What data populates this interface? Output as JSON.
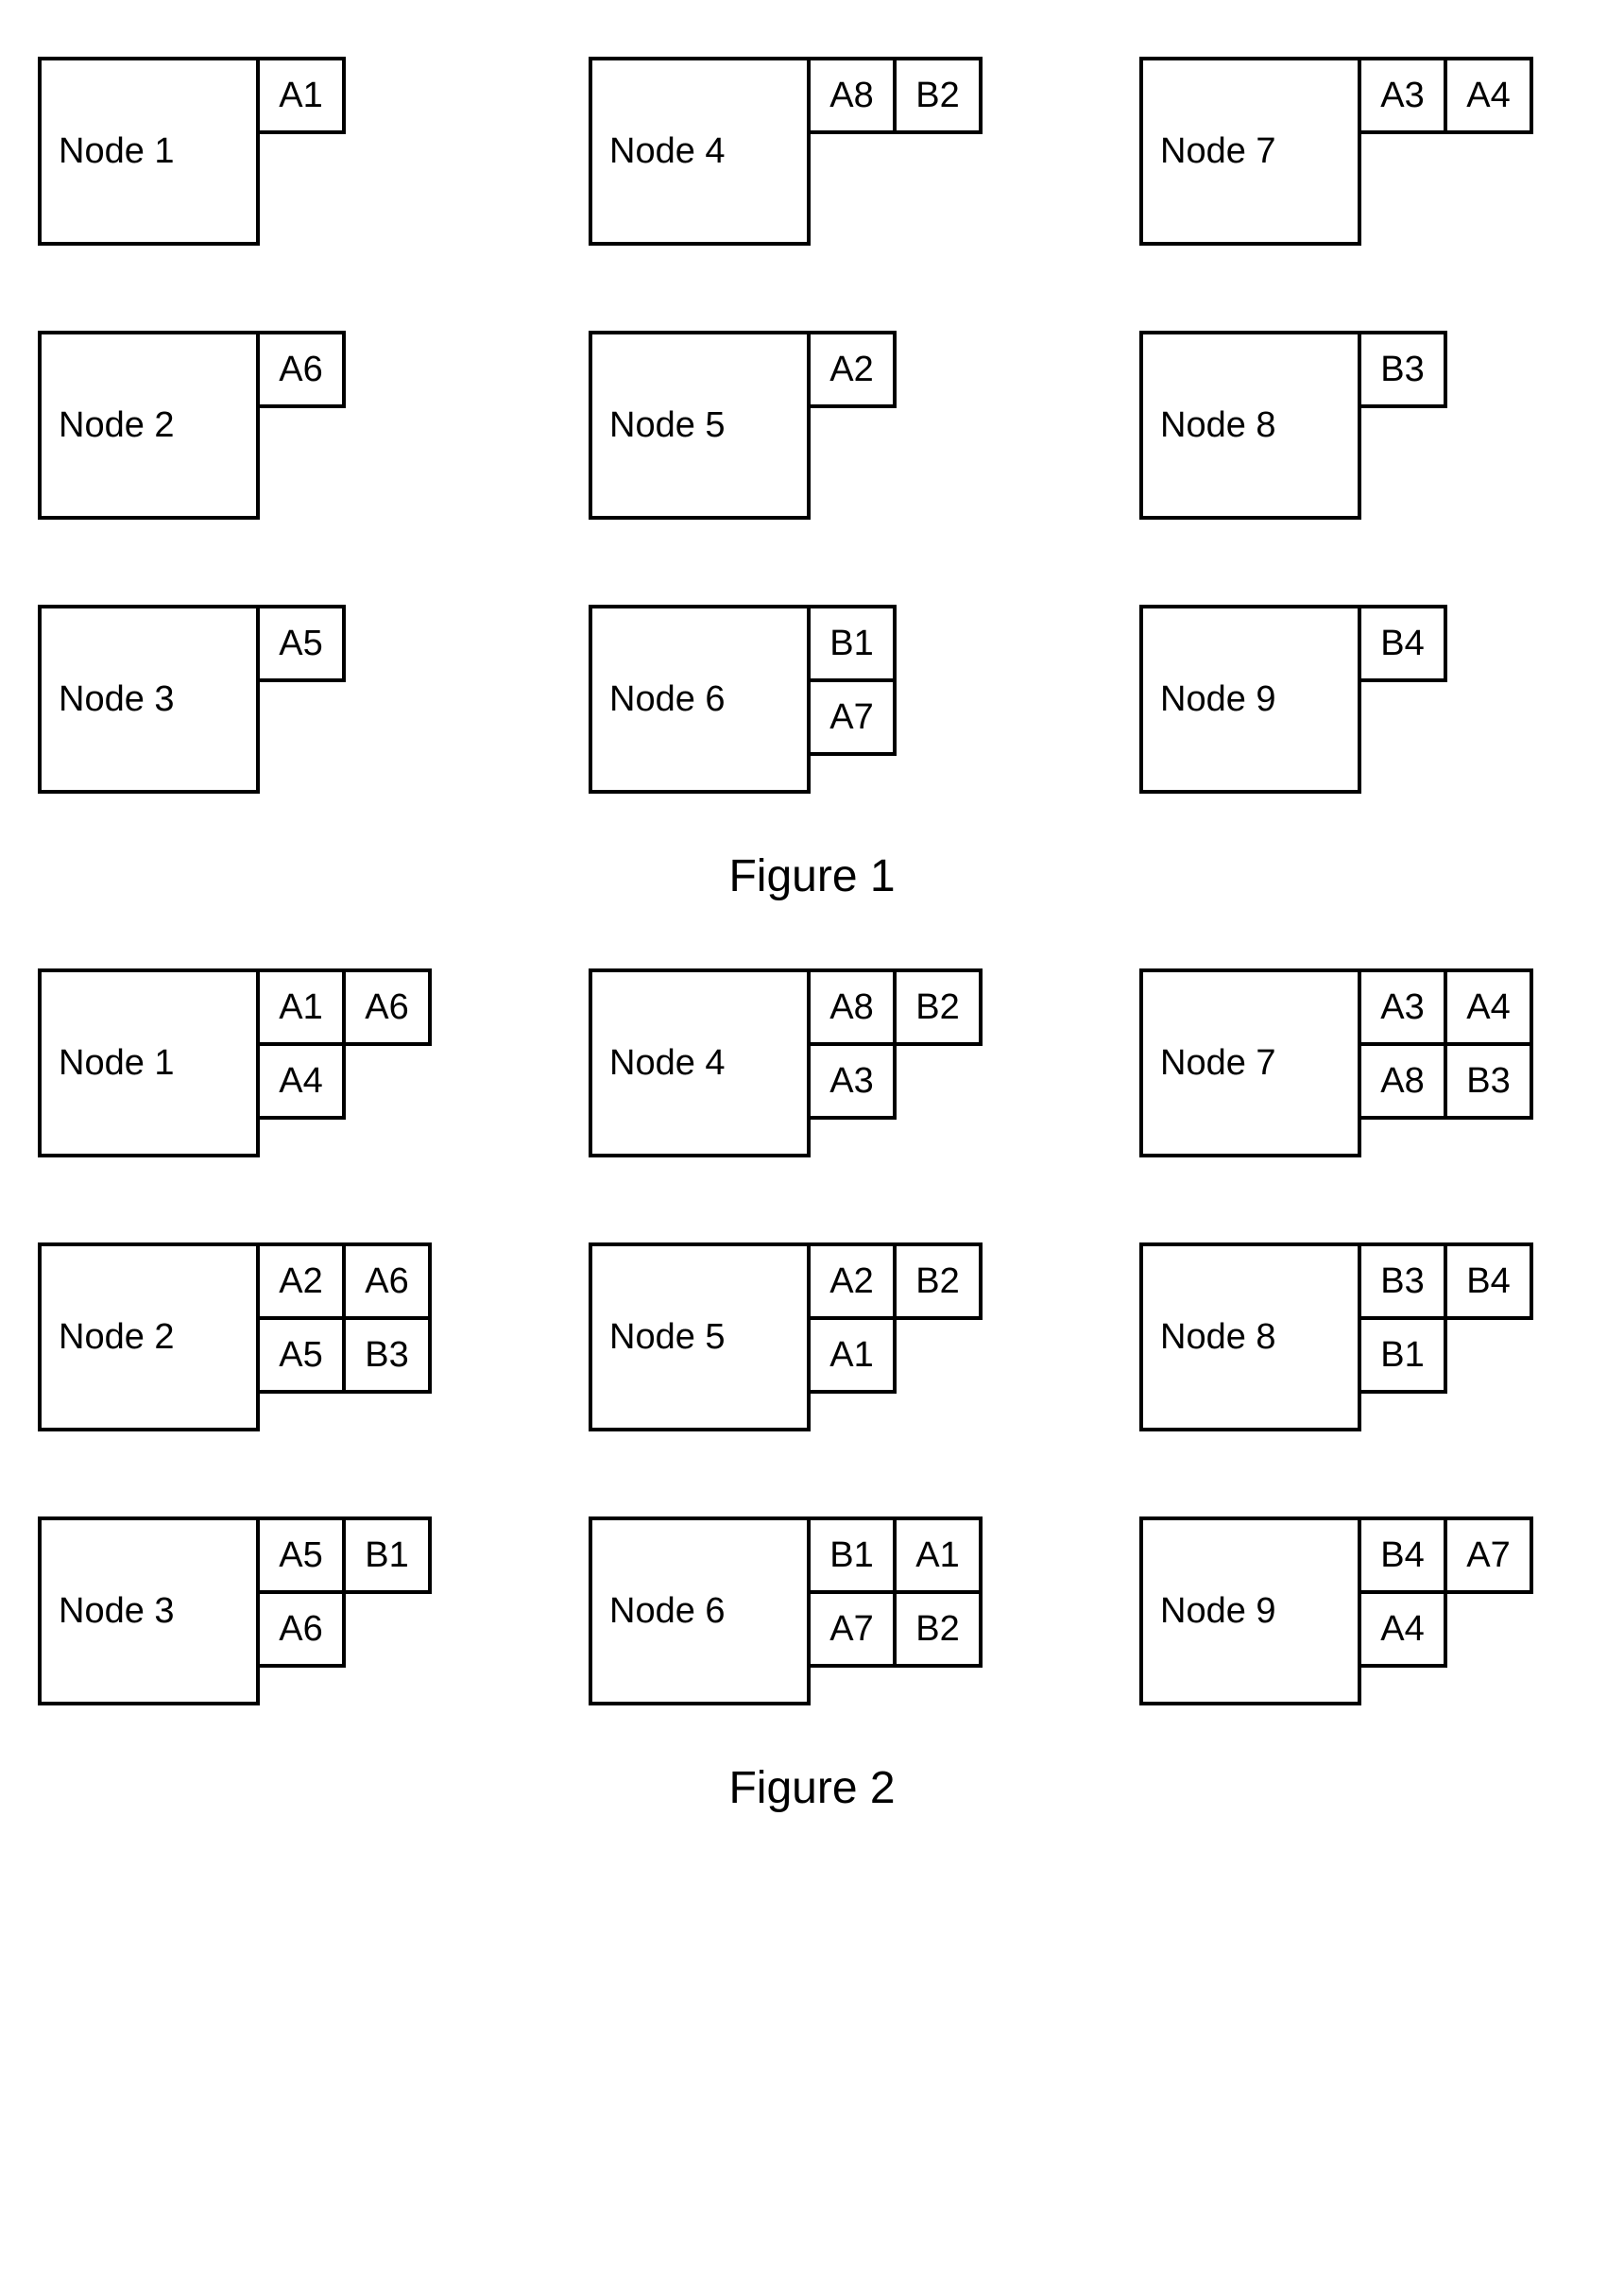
{
  "figures": [
    {
      "caption": "Figure 1",
      "nodes": [
        {
          "label": "Node 1",
          "slots": [
            [
              "A1",
              null
            ],
            [
              null,
              null
            ]
          ]
        },
        {
          "label": "Node 4",
          "slots": [
            [
              "A8",
              "B2"
            ],
            [
              null,
              null
            ]
          ]
        },
        {
          "label": "Node 7",
          "slots": [
            [
              "A3",
              "A4"
            ],
            [
              null,
              null
            ]
          ]
        },
        {
          "label": "Node 2",
          "slots": [
            [
              "A6",
              null
            ],
            [
              null,
              null
            ]
          ]
        },
        {
          "label": "Node 5",
          "slots": [
            [
              "A2",
              null
            ],
            [
              null,
              null
            ]
          ]
        },
        {
          "label": "Node 8",
          "slots": [
            [
              "B3",
              null
            ],
            [
              null,
              null
            ]
          ]
        },
        {
          "label": "Node 3",
          "slots": [
            [
              "A5",
              null
            ],
            [
              null,
              null
            ]
          ]
        },
        {
          "label": "Node 6",
          "slots": [
            [
              "B1",
              null
            ],
            [
              "A7",
              null
            ]
          ]
        },
        {
          "label": "Node 9",
          "slots": [
            [
              "B4",
              null
            ],
            [
              null,
              null
            ]
          ]
        }
      ]
    },
    {
      "caption": "Figure 2",
      "nodes": [
        {
          "label": "Node 1",
          "slots": [
            [
              "A1",
              "A6"
            ],
            [
              "A4",
              null
            ]
          ]
        },
        {
          "label": "Node 4",
          "slots": [
            [
              "A8",
              "B2"
            ],
            [
              "A3",
              null
            ]
          ]
        },
        {
          "label": "Node 7",
          "slots": [
            [
              "A3",
              "A4"
            ],
            [
              "A8",
              "B3"
            ]
          ]
        },
        {
          "label": "Node 2",
          "slots": [
            [
              "A2",
              "A6"
            ],
            [
              "A5",
              "B3"
            ]
          ]
        },
        {
          "label": "Node 5",
          "slots": [
            [
              "A2",
              "B2"
            ],
            [
              "A1",
              null
            ]
          ]
        },
        {
          "label": "Node 8",
          "slots": [
            [
              "B3",
              "B4"
            ],
            [
              "B1",
              null
            ]
          ]
        },
        {
          "label": "Node 3",
          "slots": [
            [
              "A5",
              "B1"
            ],
            [
              "A6",
              null
            ]
          ]
        },
        {
          "label": "Node 6",
          "slots": [
            [
              "B1",
              "A1"
            ],
            [
              "A7",
              "B2"
            ]
          ]
        },
        {
          "label": "Node 9",
          "slots": [
            [
              "B4",
              "A7"
            ],
            [
              "A4",
              null
            ]
          ]
        }
      ]
    }
  ]
}
